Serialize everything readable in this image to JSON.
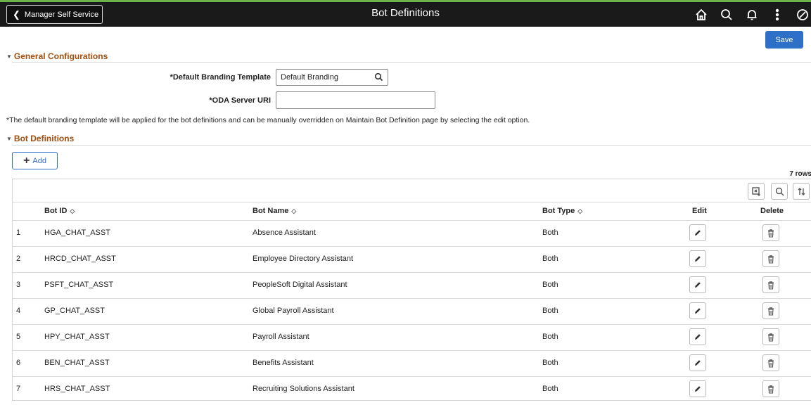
{
  "header": {
    "back_label": "Manager Self Service",
    "title": "Bot Definitions",
    "icons": [
      "home-icon",
      "search-icon",
      "notification-bell-icon",
      "actions-menu-icon",
      "navbar-icon"
    ]
  },
  "toolbar": {
    "save_label": "Save"
  },
  "general": {
    "section_label": "General Configurations",
    "branding_label": "*Default Branding Template",
    "branding_value": "Default Branding",
    "oda_label": "*ODA Server URI",
    "oda_value": "",
    "note": "*The default branding template will be applied for the bot definitions and can be manually overridden on Maintain Bot Definition page by selecting the edit option."
  },
  "bot_defs": {
    "section_label": "Bot Definitions",
    "add_label": "Add",
    "row_count": "7 rows",
    "columns": {
      "bot_id": "Bot ID",
      "bot_name": "Bot Name",
      "bot_type": "Bot Type",
      "edit": "Edit",
      "delete": "Delete"
    },
    "rows": [
      {
        "num": "1",
        "id": "HGA_CHAT_ASST",
        "name": "Absence Assistant",
        "type": "Both"
      },
      {
        "num": "2",
        "id": "HRCD_CHAT_ASST",
        "name": "Employee Directory Assistant",
        "type": "Both"
      },
      {
        "num": "3",
        "id": "PSFT_CHAT_ASST",
        "name": "PeopleSoft Digital Assistant",
        "type": "Both"
      },
      {
        "num": "4",
        "id": "GP_CHAT_ASST",
        "name": "Global Payroll Assistant",
        "type": "Both"
      },
      {
        "num": "5",
        "id": "HPY_CHAT_ASST",
        "name": "Payroll Assistant",
        "type": "Both"
      },
      {
        "num": "6",
        "id": "BEN_CHAT_ASST",
        "name": "Benefits Assistant",
        "type": "Both"
      },
      {
        "num": "7",
        "id": "HRS_CHAT_ASST",
        "name": "Recruiting Solutions Assistant",
        "type": "Both"
      }
    ]
  },
  "colors": {
    "accent": "#2e6fc7",
    "section": "#a04d0d",
    "header_bg": "#1a1a1a",
    "header_stripe": "#6bb24a"
  }
}
